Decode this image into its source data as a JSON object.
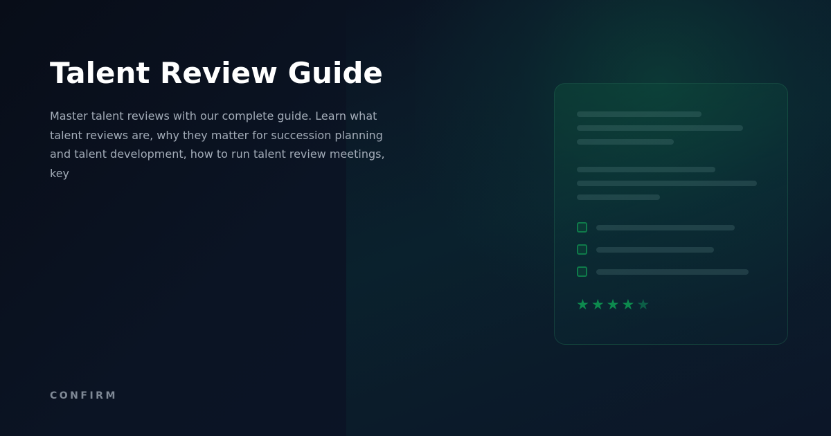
{
  "hero": {
    "title": "Talent Review Guide",
    "description": "Master talent reviews with our complete guide. Learn what talent reviews are, why they matter for succession planning and talent development, how to run talent review meetings, key",
    "brand": "CONFIRM"
  },
  "illustration": {
    "rating": {
      "filled": 4,
      "max": 5
    },
    "star_glyph": "★",
    "checklist_count": 3
  },
  "colors": {
    "background": "#0b1220",
    "accent": "#0d8a4e",
    "title": "#ffffff",
    "body_text": "#a3acb8",
    "brand_text": "#7f8996"
  }
}
